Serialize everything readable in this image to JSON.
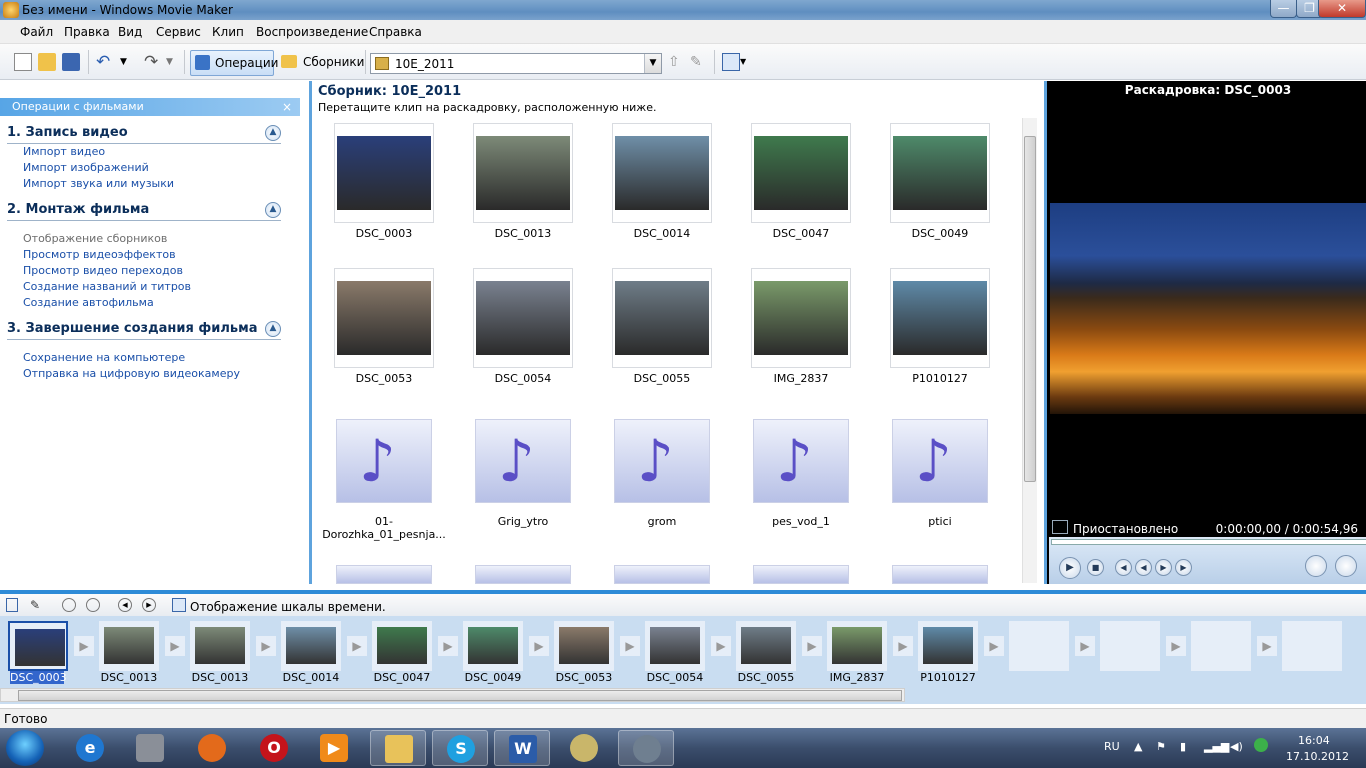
{
  "window": {
    "title": "Без имени - Windows Movie Maker",
    "minimize": "—",
    "maximize": "❐",
    "close": "✕"
  },
  "menu": [
    "Файл",
    "Правка",
    "Вид",
    "Сервис",
    "Клип",
    "Воспроизведение",
    "Справка"
  ],
  "toolbar": {
    "operations_label": "Операции",
    "collections_label": "Сборники",
    "collection_value": "10E_2011"
  },
  "taskpane": {
    "header": "Операции с фильмами",
    "close": "×",
    "sections": [
      {
        "title": "1. Запись видео",
        "links": [
          "Импорт видео",
          "Импорт изображений",
          "Импорт звука или музыки"
        ]
      },
      {
        "title": "2. Монтаж фильма",
        "links": [
          "Отображение сборников",
          "Просмотр видеоэффектов",
          "Просмотр видео переходов",
          "Создание названий и титров",
          "Создание автофильма"
        ]
      },
      {
        "title": "3. Завершение создания фильма",
        "links": [
          "Сохранение на компьютере",
          "Отправка на цифровую видеокамеру"
        ]
      }
    ]
  },
  "collection": {
    "title": "Сборник: 10E_2011",
    "hint": "Перетащите клип на раскадровку, расположенную ниже.",
    "clips": [
      {
        "name": "DSC_0003",
        "color": "#2a3f7a"
      },
      {
        "name": "DSC_0013",
        "color": "#7d8a78"
      },
      {
        "name": "DSC_0014",
        "color": "#6f8fa8"
      },
      {
        "name": "DSC_0047",
        "color": "#3f7a4d"
      },
      {
        "name": "DSC_0049",
        "color": "#4e8a6a"
      },
      {
        "name": "DSC_0053",
        "color": "#8a7a6a"
      },
      {
        "name": "DSC_0054",
        "color": "#7a8290"
      },
      {
        "name": "DSC_0055",
        "color": "#6f7d88"
      },
      {
        "name": "IMG_2837",
        "color": "#7a9a6a"
      },
      {
        "name": "P1010127",
        "color": "#5f8aa8"
      }
    ],
    "audio": [
      "01-Dorozhka_01_pesnja...",
      "Grig_ytro",
      "grom",
      "pes_vod_1",
      "ptici"
    ]
  },
  "preview": {
    "title": "Раскадровка: DSC_0003",
    "status": "Приостановлено",
    "time": "0:00:00,00 / 0:00:54,96"
  },
  "timeline": {
    "toggle_label": "Отображение шкалы времени.",
    "items": [
      "DSC_0003",
      "DSC_0013",
      "DSC_0013",
      "DSC_0014",
      "DSC_0047",
      "DSC_0049",
      "DSC_0053",
      "DSC_0054",
      "DSC_0055",
      "IMG_2837",
      "P1010127"
    ]
  },
  "statusbar": {
    "text": "Готово"
  },
  "taskbar": {
    "lang": "RU",
    "time": "16:04",
    "date": "17.10.2012"
  }
}
